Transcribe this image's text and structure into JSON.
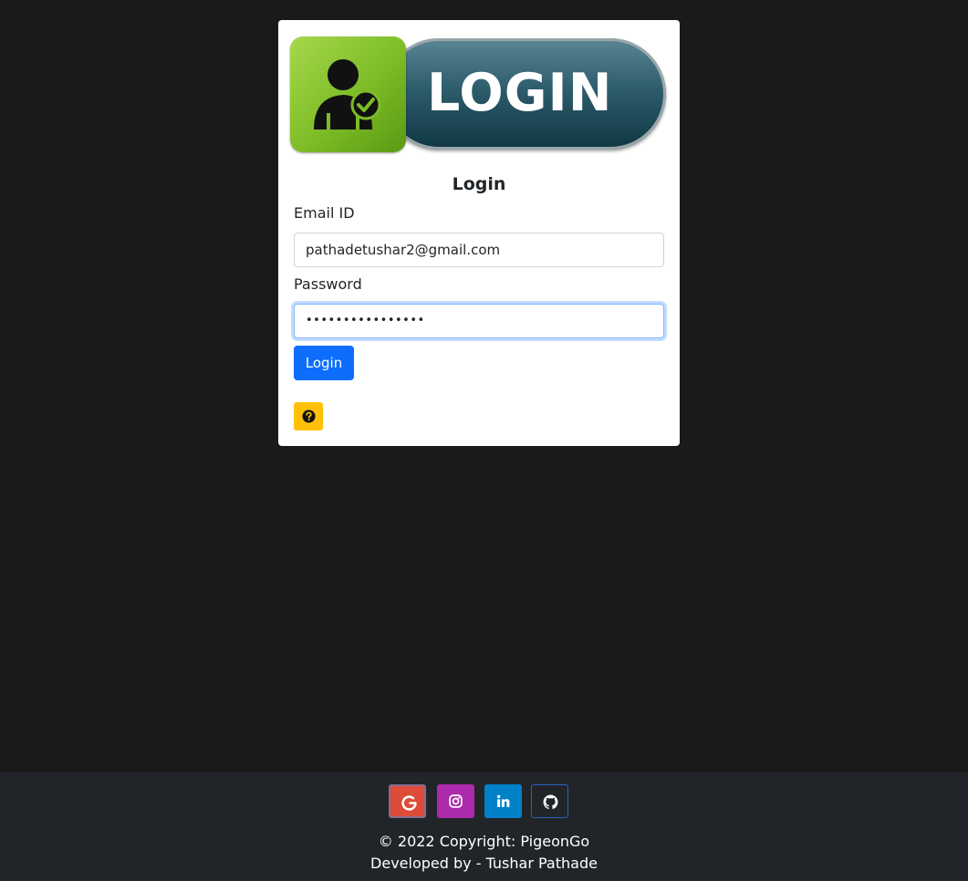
{
  "banner": {
    "text": "LOGIN"
  },
  "form": {
    "title": "Login",
    "email_label": "Email ID",
    "email_value": "pathadetushar2@gmail.com",
    "password_label": "Password",
    "password_value": "••••••••••••••••",
    "login_button": "Login",
    "help_icon": "question-circle-icon"
  },
  "footer": {
    "social": [
      {
        "name": "google",
        "color": "#dd4b39"
      },
      {
        "name": "instagram",
        "color": "#ac2bac"
      },
      {
        "name": "linkedin",
        "color": "#0082ca"
      },
      {
        "name": "github",
        "color": "#212529"
      }
    ],
    "copyright": "© 2022 Copyright: PigeonGo",
    "developer": "Developed by - Tushar Pathade"
  },
  "colors": {
    "background": "#1a1a1b",
    "primary": "#0d6efd",
    "warning": "#ffc107",
    "footer_bg": "#212529"
  }
}
